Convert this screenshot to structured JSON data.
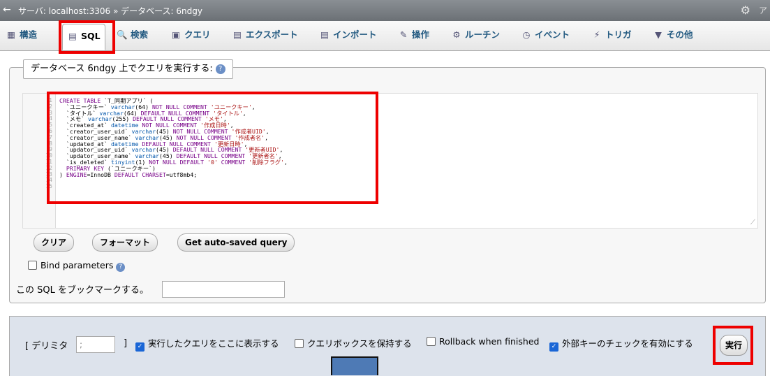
{
  "topbar": {
    "back_icon": "←",
    "breadcrumb": "サーバ: localhost:3306 » データベース: 6ndgy",
    "gear_icon": "⚙",
    "more": "ア"
  },
  "tabs": [
    {
      "label": "構造",
      "icon": "structure-icon",
      "glyph": "▦"
    },
    {
      "label": "SQL",
      "icon": "sql-icon",
      "glyph": "▤"
    },
    {
      "label": "検索",
      "icon": "search-icon",
      "glyph": "🔍"
    },
    {
      "label": "クエリ",
      "icon": "query-icon",
      "glyph": "▣"
    },
    {
      "label": "エクスポート",
      "icon": "export-icon",
      "glyph": "▤"
    },
    {
      "label": "インポート",
      "icon": "import-icon",
      "glyph": "▤"
    },
    {
      "label": "操作",
      "icon": "wrench-icon",
      "glyph": "✎"
    },
    {
      "label": "ルーチン",
      "icon": "routines-icon",
      "glyph": "⚙"
    },
    {
      "label": "イベント",
      "icon": "clock-icon",
      "glyph": "◷"
    },
    {
      "label": "トリガ",
      "icon": "trigger-icon",
      "glyph": "⚡"
    },
    {
      "label": "その他",
      "icon": "chevron-down-icon",
      "glyph": "▼"
    }
  ],
  "legend": {
    "text": "データベース 6ndgy 上でクエリを実行する:",
    "help_icon": "?"
  },
  "editor": {
    "line_numbers": [
      "1",
      "2",
      "3",
      "4",
      "5",
      "6",
      "7",
      "8",
      "9",
      "10",
      "11",
      "12",
      "13",
      "14",
      "15"
    ],
    "code_lines": [
      "CREATE TABLE `T_同期アプリ` (",
      "  `ユニークキー` varchar(64) NOT NULL COMMENT 'ユニークキー',",
      "  `タイトル` varchar(64) DEFAULT NULL COMMENT 'タイトル',",
      "  `メモ` varchar(255) DEFAULT NULL COMMENT 'メモ',",
      "  `created_at` datetime NOT NULL COMMENT '作成日時',",
      "  `creator_user_uid` varchar(45) NOT NULL COMMENT '作成者UID',",
      "  `creator_user_name` varchar(45) NOT NULL COMMENT '作成者名',",
      "  `updated_at` datetime DEFAULT NULL COMMENT '更新日時',",
      "  `updator_user_uid` varchar(45) DEFAULT NULL COMMENT '更新者UID',",
      "  `updator_user_name` varchar(45) DEFAULT NULL COMMENT '更新者名',",
      "  `is_deleted` tinyint(1) NOT NULL DEFAULT '0' COMMENT '削除フラグ',",
      "  PRIMARY KEY (`ユニークキー`)",
      ") ENGINE=InnoDB DEFAULT CHARSET=utf8mb4;"
    ]
  },
  "buttons": {
    "clear": "クリア",
    "format": "フォーマット",
    "autosaved": "Get auto-saved query"
  },
  "bind_parameters": {
    "label": "Bind parameters",
    "checked": false
  },
  "bookmark": {
    "label": "この SQL をブックマークする。",
    "value": ""
  },
  "footer": {
    "delimiter_label": "[ デリミタ",
    "delimiter_value": ";",
    "delimiter_close": "]",
    "options": [
      {
        "label": "実行したクエリをここに表示する",
        "checked": true
      },
      {
        "label": "クエリボックスを保持する",
        "checked": false
      },
      {
        "label": "Rollback when finished",
        "checked": false
      },
      {
        "label": "外部キーのチェックを有効にする",
        "checked": true
      }
    ],
    "go_label": "実行"
  },
  "colors": {
    "highlight": "#e00000",
    "tab_text": "#235a81",
    "footer_bg": "#dde3ec"
  }
}
